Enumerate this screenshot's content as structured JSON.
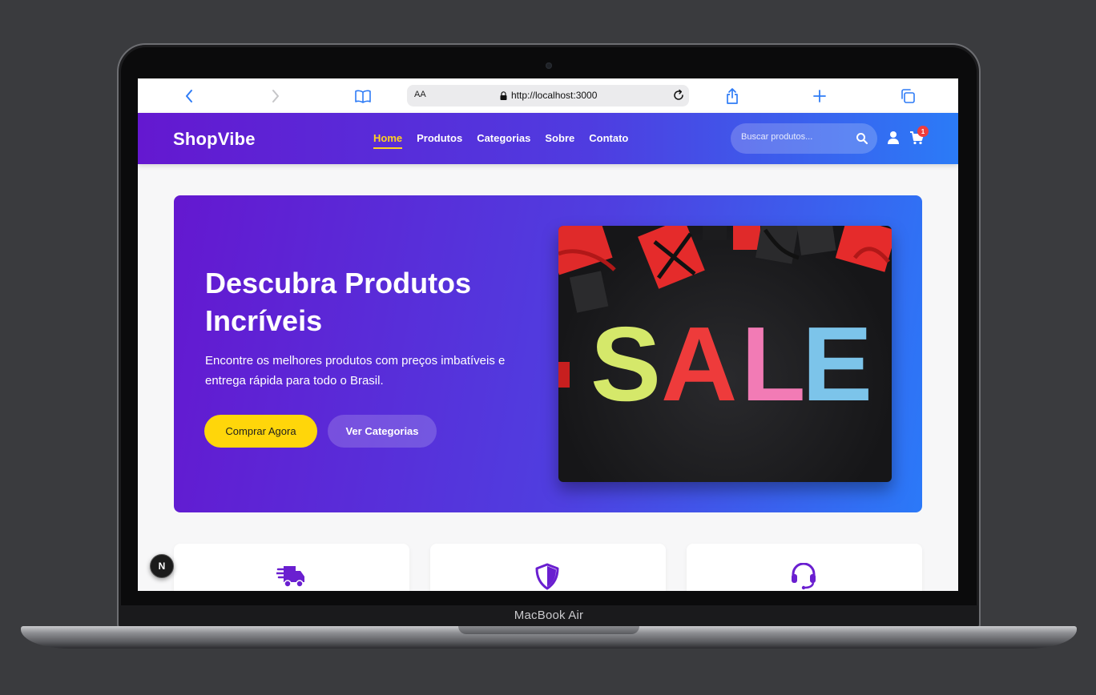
{
  "device": {
    "label": "MacBook Air"
  },
  "browser": {
    "text_size_label": "AA",
    "url": "http://localhost:3000",
    "icons": [
      "back-icon",
      "forward-icon",
      "bookmarks-icon",
      "lock-icon",
      "reload-icon",
      "share-icon",
      "new-tab-icon",
      "tabs-icon"
    ]
  },
  "header": {
    "logo": "ShopVibe",
    "nav": [
      {
        "label": "Home",
        "active": true
      },
      {
        "label": "Produtos"
      },
      {
        "label": "Categorias"
      },
      {
        "label": "Sobre"
      },
      {
        "label": "Contato"
      }
    ],
    "search_placeholder": "Buscar produtos...",
    "cart_count": "1"
  },
  "hero": {
    "title": "Descubra Produtos Incríveis",
    "subtitle": "Encontre os melhores produtos com preços imbatíveis e entrega rápida para todo o Brasil.",
    "primary_button": "Comprar Agora",
    "secondary_button": "Ver Categorias",
    "image_text": [
      "S",
      "A",
      "L",
      "E"
    ]
  },
  "features": [
    {
      "icon": "truck-icon"
    },
    {
      "icon": "shield-icon"
    },
    {
      "icon": "headset-icon"
    }
  ],
  "dev_badge": {
    "label": "N"
  },
  "colors": {
    "header_gradient_start": "#6418d0",
    "header_gradient_end": "#2b7bf7",
    "accent_yellow": "#ffd60a",
    "feature_icon": "#6a1fd0",
    "badge_red": "#ef3d3d"
  }
}
